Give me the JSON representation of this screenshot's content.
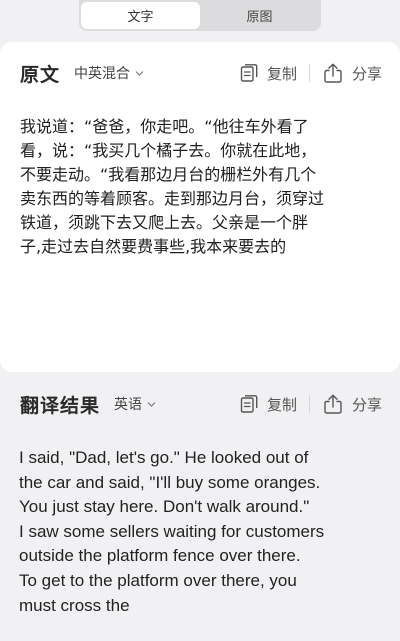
{
  "tabs": {
    "text_label": "文字",
    "image_label": "原图"
  },
  "source": {
    "title": "原文",
    "language": "中英混合",
    "copy_label": "复制",
    "share_label": "分享",
    "text": "我说道：“爸爸，你走吧。“他往车外看了\n看，说：“我买几个橘子去。你就在此地，\n不要走动。“我看那边月台的栅栏外有几个\n卖东西的等着顾客。走到那边月台，须穿过\n铁道，须跳下去又爬上去。父亲是一个胖\n子,走过去自然要费事些,我本来要去的"
  },
  "translation": {
    "title": "翻译结果",
    "language": "英语",
    "copy_label": "复制",
    "share_label": "分享",
    "text": "I said, \"Dad, let's go.\" He looked out of\nthe car and said, \"I'll buy some oranges.\nYou just stay here. Don't walk around.\"\nI saw some sellers waiting for customers\noutside the platform fence over there.\nTo get to the platform over there, you\nmust cross the"
  },
  "colors": {
    "background": "#f1f1f3",
    "card": "#ffffff",
    "tab_track": "#dcdcde"
  }
}
